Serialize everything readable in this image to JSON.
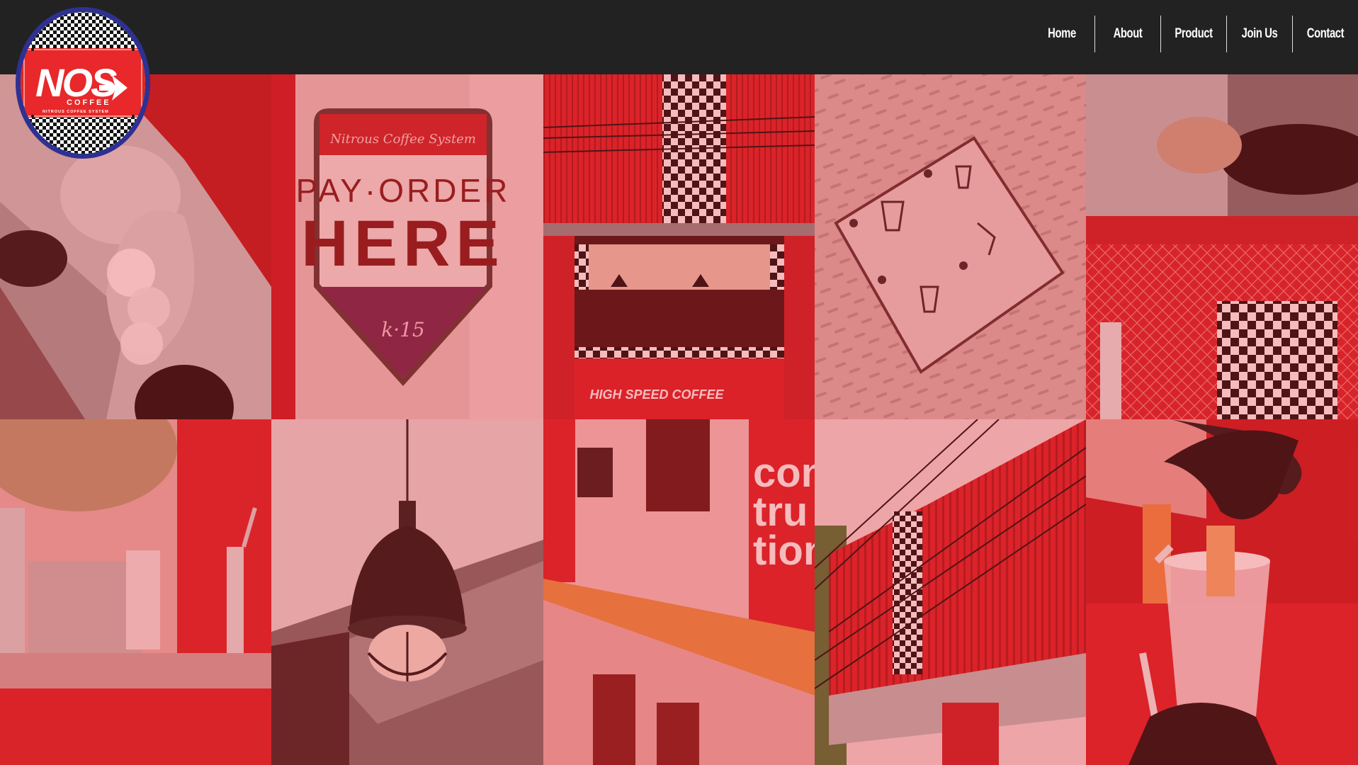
{
  "brand": {
    "logo_text": "NOS",
    "logo_subtext": "COFFEE",
    "logo_tagline": "NITROUS COFFEE SYSTEM"
  },
  "nav": {
    "items": [
      {
        "label": "Home"
      },
      {
        "label": "About"
      },
      {
        "label": "Product"
      },
      {
        "label": "Join Us"
      },
      {
        "label": "Contact"
      }
    ]
  },
  "gallery": {
    "tiles": [
      {
        "subject": "ice-scoop-photo"
      },
      {
        "subject": "pay-order-sign-photo",
        "sign_script": "Nitrous Coffee System",
        "sign_line1": "PAY·ORDER",
        "sign_line2": "HERE",
        "sign_footer": "k·15"
      },
      {
        "subject": "storefront-photo",
        "counter_text": "HIGH SPEED COFFEE"
      },
      {
        "subject": "instruction-plate-photo"
      },
      {
        "subject": "barista-gloves-photo"
      },
      {
        "subject": "tap-counter-photo"
      },
      {
        "subject": "pendant-lamp-photo"
      },
      {
        "subject": "wooden-bar-photo",
        "wall_text": [
          "con",
          "tru",
          "tion"
        ]
      },
      {
        "subject": "building-facade-photo"
      },
      {
        "subject": "drink-pour-photo"
      }
    ]
  },
  "colors": {
    "header_bg": "#222222",
    "accent_red": "#e2231a",
    "logo_blue": "#2e3192",
    "nav_text": "#ffffff"
  }
}
